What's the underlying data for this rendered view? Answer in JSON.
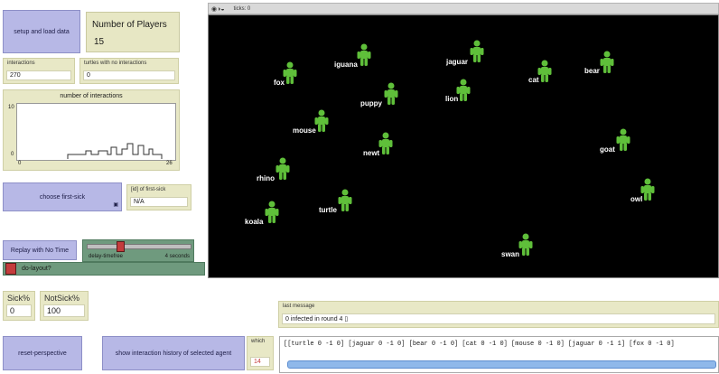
{
  "buttons": {
    "setup": "setup and load data",
    "choose_first_sick": "choose first-sick",
    "replay": "Replay with No Time",
    "do_layout": "do-layout?",
    "reset_perspective": "reset-perspective",
    "show_history": "show interaction history of selected agent"
  },
  "number_of_players": {
    "label": "Number of Players",
    "value": "15"
  },
  "monitors": {
    "interactions": {
      "label": "interactions",
      "value": "270"
    },
    "no_interactions": {
      "label": "turtles with no interactions",
      "value": "0"
    },
    "first_sick_id": {
      "label": "[id] of first-sick",
      "value": "N/A"
    },
    "sick_pct": {
      "label": "Sick%",
      "value": "0"
    },
    "not_sick_pct": {
      "label": "NotSick%",
      "value": "100"
    },
    "last_message": {
      "label": "last message",
      "value": "0 infected in round 4 ▯"
    },
    "which": {
      "label": "which",
      "value": "14"
    }
  },
  "plot": {
    "title": "number of interactions",
    "y_max": "10",
    "y_min": "0",
    "x_min": "0",
    "x_max": "26"
  },
  "slider": {
    "label": "delay-timefree",
    "value": "4 seconds",
    "level": 0.3
  },
  "world": {
    "title": "ticks: 0",
    "agents": [
      {
        "name": "iguana"
      },
      {
        "name": "jaguar"
      },
      {
        "name": "fox"
      },
      {
        "name": "cat"
      },
      {
        "name": "bear"
      },
      {
        "name": "puppy"
      },
      {
        "name": "lion"
      },
      {
        "name": "mouse"
      },
      {
        "name": "newt"
      },
      {
        "name": "goat"
      },
      {
        "name": "rhino"
      },
      {
        "name": "turtle"
      },
      {
        "name": "owl"
      },
      {
        "name": "koala"
      },
      {
        "name": "swan"
      }
    ]
  },
  "output_text": "[[turtle 0 -1 0] [jaguar 0 -1 0] [bear 0 -1 0] [cat 0 -1 0] [mouse 0 -1 0] [jaguar 0 -1 1] [fox 0 -1 0]",
  "colors": {
    "agent": "#5fbf3a",
    "button": "#b7b8e6",
    "monitor": "#e8e8c6"
  }
}
